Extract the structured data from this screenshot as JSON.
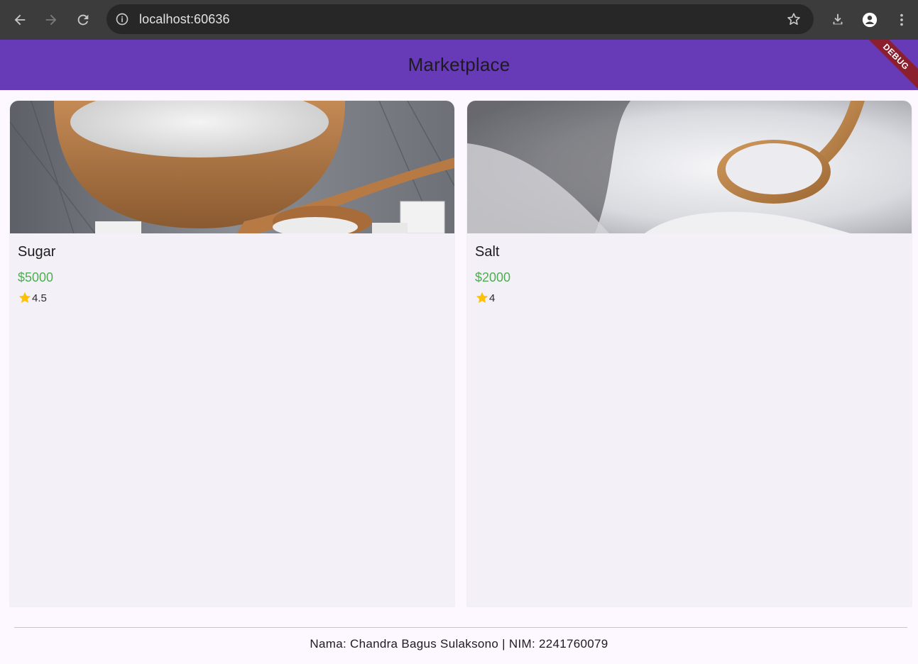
{
  "browser": {
    "url": "localhost:60636",
    "icons": {
      "back": "back-arrow-icon",
      "forward": "forward-arrow-icon",
      "reload": "reload-icon",
      "info": "info-icon",
      "bookmark": "star-outline-icon",
      "download": "download-icon",
      "profile": "profile-icon",
      "menu": "vertical-dots-icon"
    }
  },
  "appbar": {
    "title": "Marketplace",
    "color": "#673ab7",
    "debug_label": "DEBUG"
  },
  "products": [
    {
      "name": "Sugar",
      "price": "$5000",
      "rating": "4.5",
      "image_subject": "bowl of sugar with wooden spoon"
    },
    {
      "name": "Salt",
      "price": "$2000",
      "rating": "4",
      "image_subject": "salt with wooden spoon"
    }
  ],
  "colors": {
    "price": "#4caf50",
    "star": "#ffc107",
    "background": "#fdf7ff",
    "card": "#f4f0f7"
  },
  "footer": {
    "text": "Nama: Chandra Bagus Sulaksono | NIM: 2241760079"
  }
}
